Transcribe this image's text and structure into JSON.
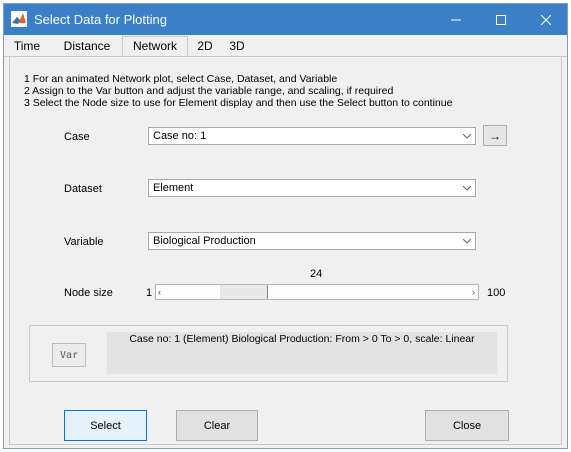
{
  "window": {
    "title": "Select Data for Plotting",
    "accent_color": "#3b7fc7",
    "icons": [
      "matlab-icon",
      "minimize-icon",
      "maximize-icon",
      "close-icon"
    ]
  },
  "tabs": [
    {
      "label": "Time",
      "active": false
    },
    {
      "label": "Distance",
      "active": false
    },
    {
      "label": "Network",
      "active": true
    },
    {
      "label": "2D",
      "active": false
    },
    {
      "label": "3D",
      "active": false
    }
  ],
  "instructions": [
    "1 For an animated Network plot, select Case, Dataset, and Variable",
    "2 Assign to the Var button and adjust the variable range, and scaling, if required",
    "3 Select the Node size to use for Element display and then use the Select button to continue"
  ],
  "case": {
    "label": "Case",
    "value": "Case no: 1",
    "arrow_button": "→"
  },
  "dataset": {
    "label": "Dataset",
    "value": "Element"
  },
  "variable": {
    "label": "Variable",
    "value": "Biological Production"
  },
  "node_size": {
    "label": "Node size",
    "value": "24",
    "min": "1",
    "max": "100"
  },
  "var_panel": {
    "button_label": "Var",
    "description": "Case no: 1 (Element) Biological Production: From > 0 To > 0, scale: Linear"
  },
  "buttons": {
    "select": "Select",
    "clear": "Clear",
    "close": "Close"
  }
}
